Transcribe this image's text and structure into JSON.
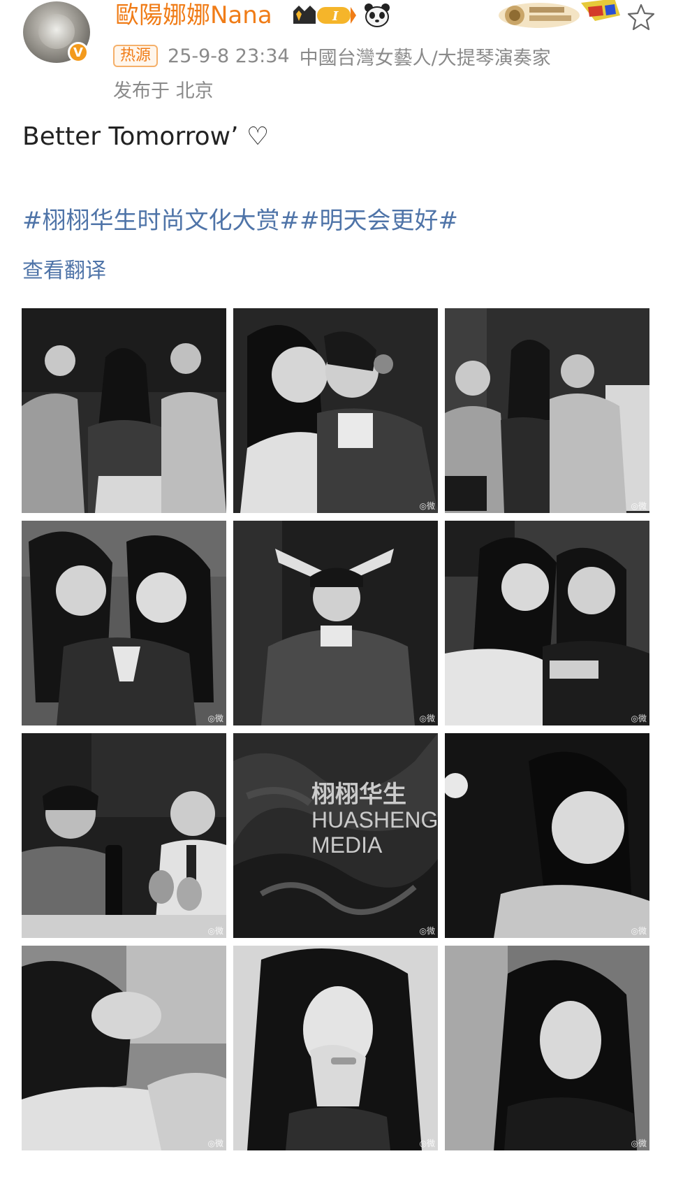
{
  "user": {
    "name": "歐陽娜娜Nana",
    "verified_badge": "V",
    "level_badge": "I",
    "accent_color": "#f07c17"
  },
  "meta": {
    "hot_tag": "热源",
    "timestamp": "25-9-8 23:34",
    "bio": "中國台灣女藝人/大提琴演奏家",
    "location": "发布于 北京"
  },
  "post": {
    "text": "Better Tomorrow’ ♡",
    "hashtags": "#栩栩华生时尚文化大赏##明天会更好#",
    "translate_label": "查看翻译",
    "link_color": "#4f74a8"
  },
  "images": {
    "watermark": "◎微",
    "overlay_cn": "栩栩华生",
    "overlay_en1": "HUASHENG",
    "overlay_en2": "MEDIA"
  },
  "icons": [
    "avatar",
    "verified-icon",
    "level-badge-icon",
    "panda-icon",
    "decoration-badge",
    "star-icon"
  ]
}
